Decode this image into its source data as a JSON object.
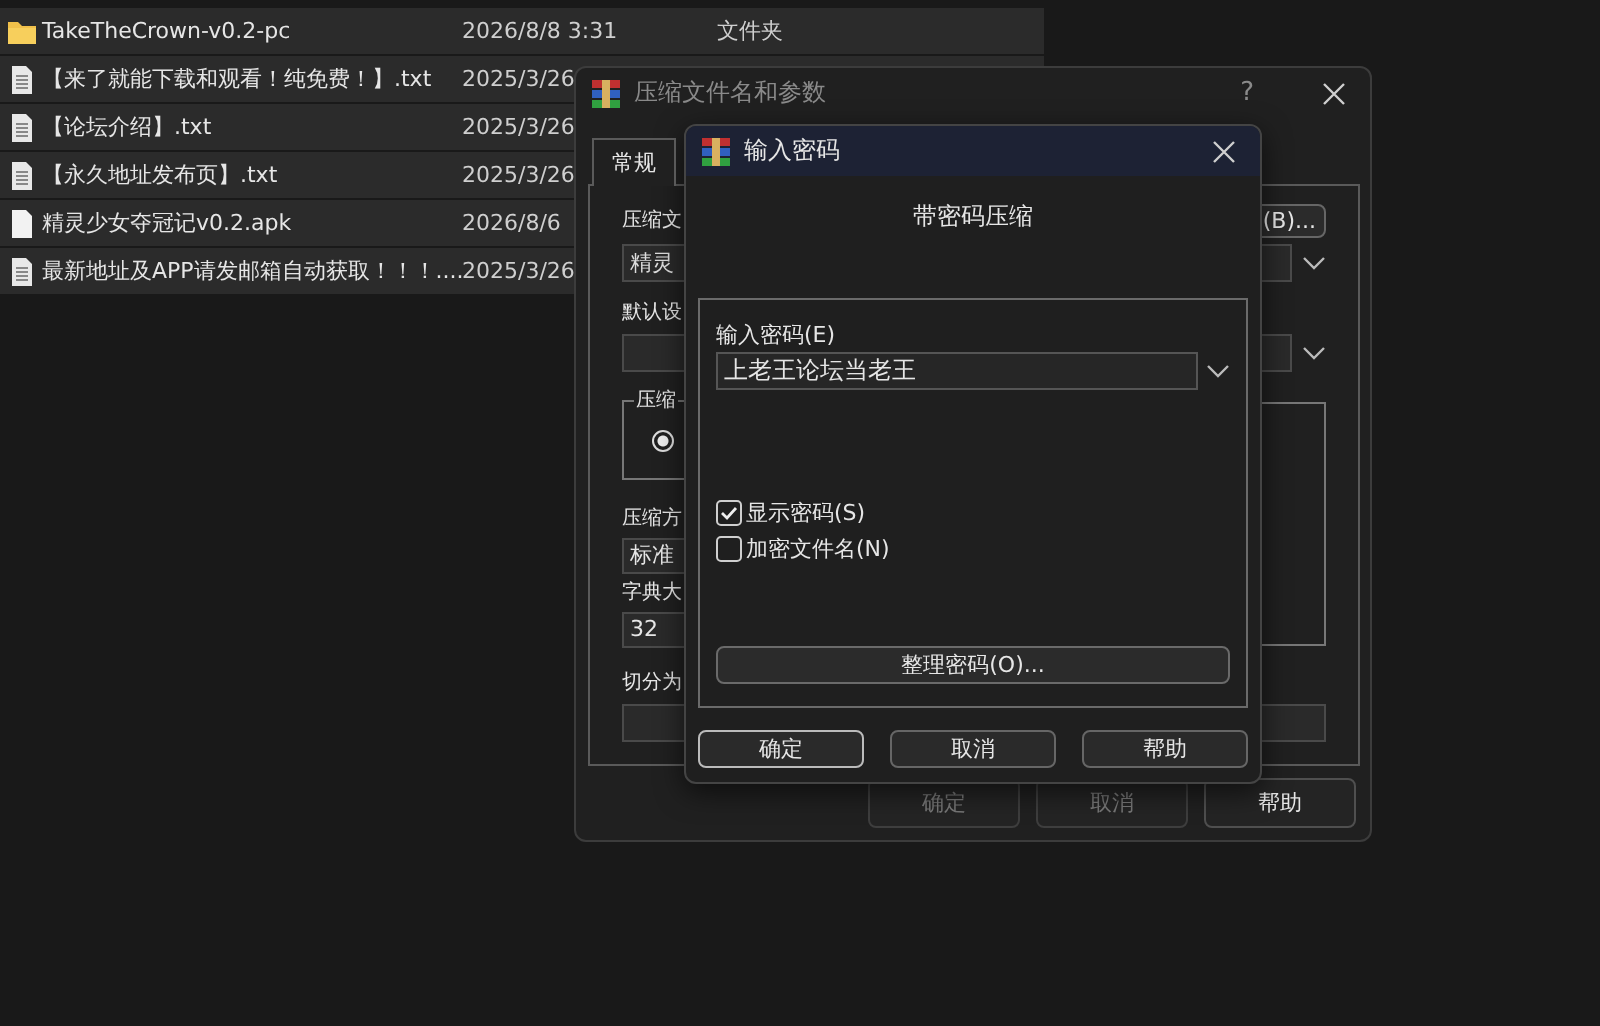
{
  "files": [
    {
      "kind": "folder",
      "name": "TakeTheCrown-v0.2-pc",
      "date": "2026/8/8 3:31",
      "type": "文件夹"
    },
    {
      "kind": "text",
      "name": "【来了就能下载和观看！纯免费！】.txt",
      "date": "2025/3/26"
    },
    {
      "kind": "text",
      "name": "【论坛介绍】.txt",
      "date": "2025/3/26"
    },
    {
      "kind": "text",
      "name": "【永久地址发布页】.txt",
      "date": "2025/3/26"
    },
    {
      "kind": "file",
      "name": "精灵少女夺冠记v0.2.apk",
      "date": "2026/8/6"
    },
    {
      "kind": "text",
      "name": "最新地址及APP请发邮箱自动获取！！！....",
      "date": "2025/3/26"
    }
  ],
  "back_dialog": {
    "title": "压缩文件名和参数",
    "help_glyph": "?",
    "tabs": [
      {
        "label": "常规",
        "selected": true
      }
    ],
    "browse_button": "(B)...",
    "archive_label": "压缩文",
    "archive_value": "精灵",
    "profile_label": "默认设",
    "format_group": {
      "label": "压缩",
      "radio_selected": true
    },
    "method_label": "压缩方",
    "method_value": "标准",
    "dict_label": "字典大",
    "dict_value": "32",
    "split_label": "切分为",
    "buttons": [
      {
        "label": "确定",
        "disabled": true
      },
      {
        "label": "取消",
        "disabled": true
      },
      {
        "label": "帮助",
        "disabled": false
      }
    ]
  },
  "front_dialog": {
    "title": "输入密码",
    "heading": "带密码压缩",
    "password_label": "输入密码(E)",
    "password": "上老王论坛当老王",
    "options": [
      {
        "label": "显示密码(S)",
        "checked": true
      },
      {
        "label": "加密文件名(N)",
        "checked": false
      }
    ],
    "manage_button": "整理密码(O)...",
    "buttons": [
      {
        "label": "确定",
        "default": true
      },
      {
        "label": "取消",
        "default": false
      },
      {
        "label": "帮助",
        "default": false
      }
    ]
  }
}
